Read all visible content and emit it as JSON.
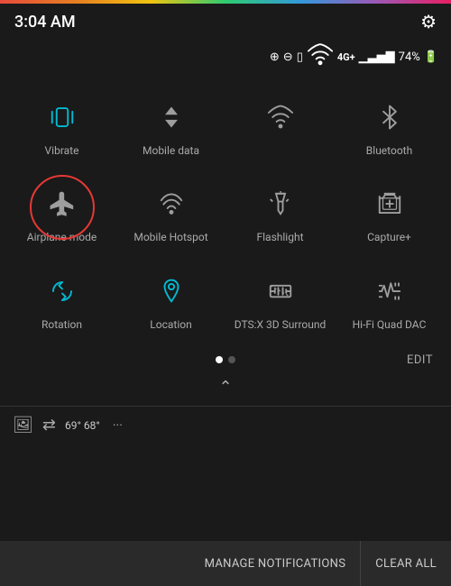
{
  "rainbow_bar": "rainbow",
  "status": {
    "time": "3:04 AM",
    "battery": "74%",
    "gear_label": "⚙"
  },
  "tiles": {
    "row1": [
      {
        "id": "vibrate",
        "label": "Vibrate",
        "active": true,
        "icon": "vibrate"
      },
      {
        "id": "mobile-data",
        "label": "Mobile data",
        "active": false,
        "icon": "mobile-data"
      },
      {
        "id": "wifi",
        "label": "",
        "active": false,
        "icon": "wifi"
      },
      {
        "id": "bluetooth",
        "label": "Bluetooth",
        "active": false,
        "icon": "bluetooth"
      }
    ],
    "row2": [
      {
        "id": "airplane-mode",
        "label": "Airplane mode",
        "active": false,
        "icon": "airplane",
        "circled": true
      },
      {
        "id": "mobile-hotspot",
        "label": "Mobile Hotspot",
        "active": false,
        "icon": "hotspot"
      },
      {
        "id": "flashlight",
        "label": "Flashlight",
        "active": false,
        "icon": "flashlight"
      },
      {
        "id": "capture-plus",
        "label": "Capture+",
        "active": false,
        "icon": "capture"
      }
    ],
    "row3": [
      {
        "id": "rotation",
        "label": "Rotation",
        "active": true,
        "icon": "rotation"
      },
      {
        "id": "location",
        "label": "Location",
        "active": true,
        "icon": "location"
      },
      {
        "id": "dts-surround",
        "label": "DTS:X 3D Surround",
        "active": false,
        "icon": "dts"
      },
      {
        "id": "hifi-dac",
        "label": "Hi-Fi Quad DAC",
        "active": false,
        "icon": "hifi"
      }
    ]
  },
  "pagination": {
    "active_dot": 0,
    "total_dots": 2
  },
  "edit_label": "EDIT",
  "notif_bar": {
    "temperature": "69° 68°",
    "dots": "···"
  },
  "bottom_bar": {
    "manage_label": "MANAGE NOTIFICATIONS",
    "clear_label": "CLEAR ALL"
  }
}
